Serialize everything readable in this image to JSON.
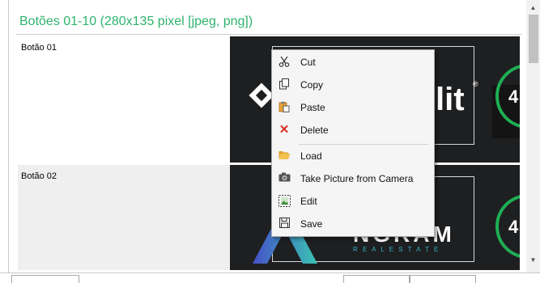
{
  "section": {
    "title": "Botões 01-10  (280x135 pixel [jpeg, png])"
  },
  "rows": [
    {
      "label": "Botão 01"
    },
    {
      "label": "Botão 02"
    }
  ],
  "preview1": {
    "logo_text": "lit",
    "registered_mark": "®",
    "ring_digit": "4"
  },
  "preview2": {
    "logo_text": "NGRAM",
    "subtitle": "R E A L   E S T A T E",
    "ring_digit": "4"
  },
  "context_menu": {
    "items": [
      {
        "label": "Cut",
        "icon": "scissors-icon"
      },
      {
        "label": "Copy",
        "icon": "copy-icon"
      },
      {
        "label": "Paste",
        "icon": "paste-icon"
      },
      {
        "label": "Delete",
        "icon": "delete-x-icon"
      },
      {
        "label": "Load",
        "icon": "folder-open-icon"
      },
      {
        "label": "Take Picture from Camera",
        "icon": "camera-icon"
      },
      {
        "label": "Edit",
        "icon": "edit-image-icon"
      },
      {
        "label": "Save",
        "icon": "floppy-disk-icon"
      }
    ]
  },
  "colors": {
    "title_green": "#2fb36d",
    "preview_bg": "#1e1f21",
    "ring_green": "#1fae55",
    "delete_red": "#d93025",
    "folder_orange": "#e8a33a"
  }
}
